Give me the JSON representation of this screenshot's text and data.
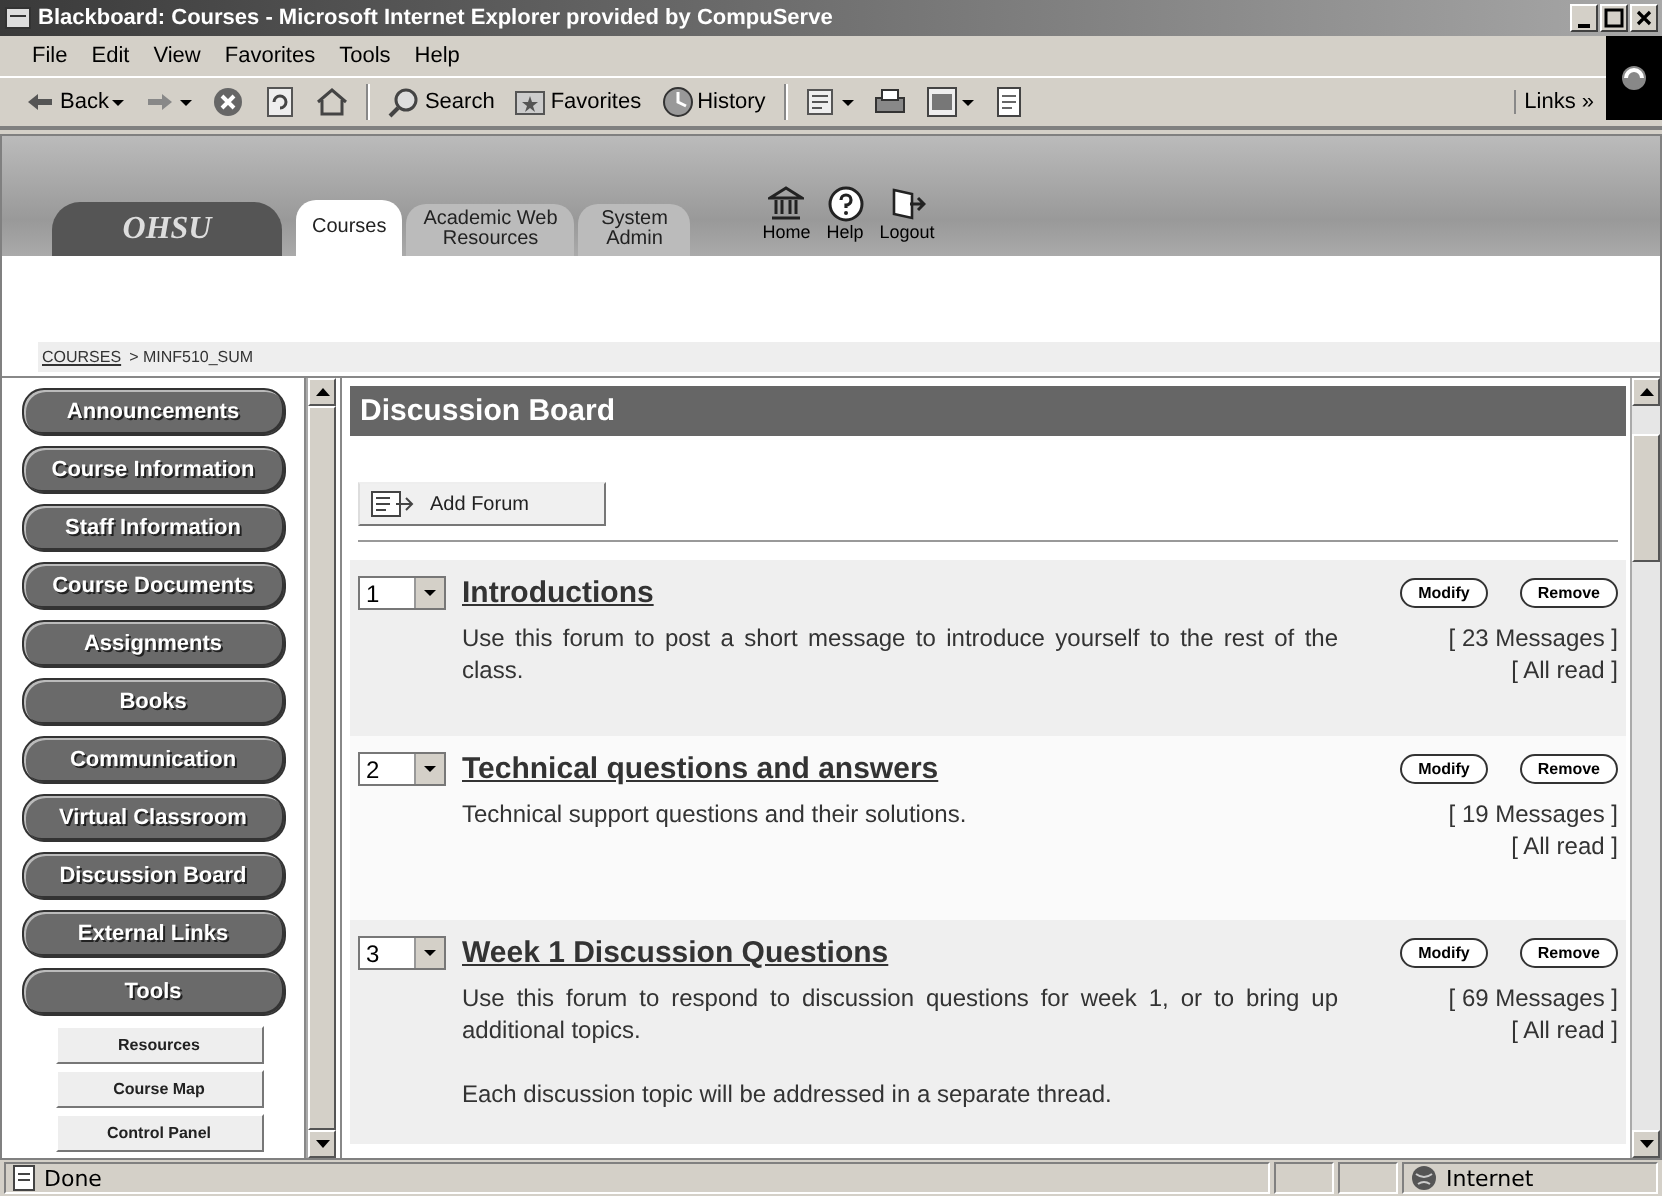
{
  "window": {
    "title": "Blackboard: Courses - Microsoft Internet Explorer provided by CompuServe"
  },
  "menu_bar": [
    "File",
    "Edit",
    "View",
    "Favorites",
    "Tools",
    "Help"
  ],
  "toolbar": [
    {
      "kind": "back",
      "label": "Back",
      "dropdown": true
    },
    {
      "kind": "forward",
      "dropdown": true
    },
    {
      "kind": "stop",
      "dropdown": false
    },
    {
      "kind": "refresh",
      "dropdown": false
    },
    {
      "kind": "home",
      "dropdown": false
    },
    {
      "kind": "search",
      "label": "Search",
      "dropdown": false
    },
    {
      "kind": "favorites",
      "label": "Favorites",
      "dropdown": false
    },
    {
      "kind": "history",
      "label": "History",
      "dropdown": false
    },
    {
      "kind": "mail",
      "dropdown": true
    },
    {
      "kind": "print",
      "dropdown": false
    },
    {
      "kind": "edit",
      "dropdown": true
    },
    {
      "kind": "discuss",
      "dropdown": false
    }
  ],
  "links": "Links »",
  "header": {
    "logo": "OHSU",
    "tabs": [
      {
        "label": "Courses",
        "selected": true
      },
      {
        "label": "Academic Web Resources",
        "selected": false
      },
      {
        "label": "System Admin",
        "selected": false
      }
    ],
    "icons": [
      {
        "kind": "home",
        "label": "Home"
      },
      {
        "kind": "help",
        "label": "Help"
      },
      {
        "kind": "logout",
        "label": "Logout"
      }
    ]
  },
  "breadcrumb": {
    "link": "COURSES",
    "current": "> MINF510_SUM"
  },
  "nav": [
    {
      "label": "Announcements",
      "kind": "main"
    },
    {
      "label": "Course Information",
      "kind": "main"
    },
    {
      "label": "Staff Information",
      "kind": "main"
    },
    {
      "label": "Course Documents",
      "kind": "main"
    },
    {
      "label": "Assignments",
      "kind": "main"
    },
    {
      "label": "Books",
      "kind": "main"
    },
    {
      "label": "Communication",
      "kind": "main"
    },
    {
      "label": "Virtual Classroom",
      "kind": "main"
    },
    {
      "label": "Discussion Board",
      "kind": "main"
    },
    {
      "label": "External Links",
      "kind": "main"
    },
    {
      "label": "Tools",
      "kind": "main"
    },
    {
      "label": "Resources",
      "kind": "sub"
    },
    {
      "label": "Course Map",
      "kind": "sub"
    },
    {
      "label": "Control Panel",
      "kind": "sub"
    }
  ],
  "main": {
    "title": "Discussion Board",
    "add_button": "Add Forum",
    "forums": [
      {
        "order": "1",
        "title": "Introductions",
        "description": [
          "Use this forum to post a short message to introduce yourself to the rest of the class."
        ],
        "messages": "[ 23 Messages ]",
        "read": "[ All read ]",
        "buttons": [
          "Modify",
          "Remove"
        ]
      },
      {
        "order": "2",
        "title": "Technical questions and answers",
        "description": [
          "Technical support questions and their solutions."
        ],
        "messages": "[ 19 Messages ]",
        "read": "[ All read ]",
        "buttons": [
          "Modify",
          "Remove"
        ]
      },
      {
        "order": "3",
        "title": "Week 1 Discussion Questions",
        "description": [
          "Use this forum to respond to discussion questions for week 1, or to bring up additional topics.",
          "Each discussion topic will be addressed in a separate thread."
        ],
        "messages": "[ 69 Messages ]",
        "read": "[ All read ]",
        "buttons": [
          "Modify",
          "Remove"
        ]
      }
    ]
  },
  "status_bar": {
    "text": "Done",
    "zone": "Internet"
  }
}
